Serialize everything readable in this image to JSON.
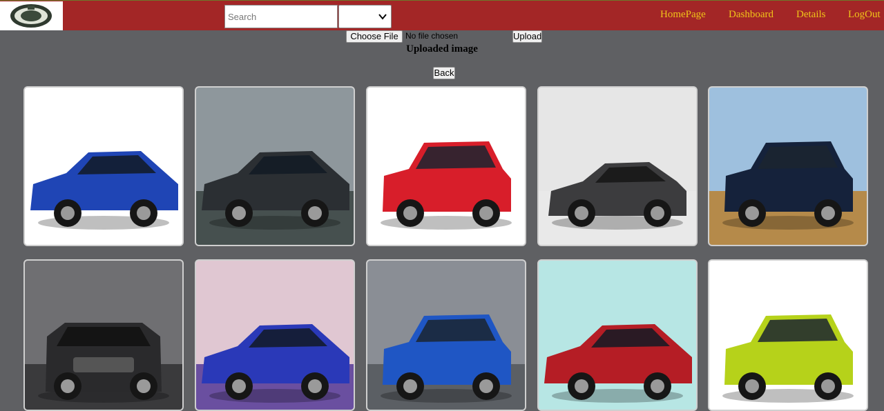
{
  "header": {
    "search_placeholder": "Search",
    "select_value": "",
    "nav": [
      "HomePage",
      "Dashboard",
      "Details",
      "LogOut"
    ]
  },
  "upload": {
    "choose_label": "Choose File",
    "no_file_text": "No file chosen",
    "upload_label": "Upload",
    "heading": "Uploaded image",
    "back_label": "Back"
  },
  "colors": {
    "topbar": "#a32626",
    "nav_text": "#f0c419",
    "page_bg": "#5f6063"
  },
  "gallery": [
    {
      "name": "blue-sedan-photo",
      "bg": "#ffffff",
      "ground": "#ffffff",
      "car": "#1f45b5",
      "type": "sedan"
    },
    {
      "name": "camo-coupe-photo",
      "bg": "#8e979c",
      "ground": "#46504f",
      "car": "#2b2f33",
      "type": "sedan"
    },
    {
      "name": "red-suv-photo",
      "bg": "#ffffff",
      "ground": "#ffffff",
      "car": "#d81e2a",
      "type": "suv"
    },
    {
      "name": "grey-coupe-photo",
      "bg": "#e6e6e6",
      "ground": "#e9e9e9",
      "car": "#3c3c3e",
      "type": "coupe"
    },
    {
      "name": "navy-suv-photo",
      "bg": "#9ec0de",
      "ground": "#b58a4a",
      "car": "#15223b",
      "type": "suv"
    },
    {
      "name": "black-accord-photo",
      "bg": "#6f6f72",
      "ground": "#3a3a3c",
      "car": "#2a2a2c",
      "type": "sedan-front"
    },
    {
      "name": "purple-sedan-photo",
      "bg": "#e0c7d2",
      "ground": "#6a4fa0",
      "car": "#2a39b8",
      "type": "sedan"
    },
    {
      "name": "blue-bmw-suv-photo",
      "bg": "#8a8e95",
      "ground": "#5b5f64",
      "car": "#1f56c4",
      "type": "suv"
    },
    {
      "name": "red-hatch-photo",
      "bg": "#b7e6e4",
      "ground": "#b7e6e4",
      "car": "#b51d25",
      "type": "sedan"
    },
    {
      "name": "lime-suv-photo",
      "bg": "#ffffff",
      "ground": "#ffffff",
      "car": "#b6d21a",
      "type": "suv"
    }
  ]
}
